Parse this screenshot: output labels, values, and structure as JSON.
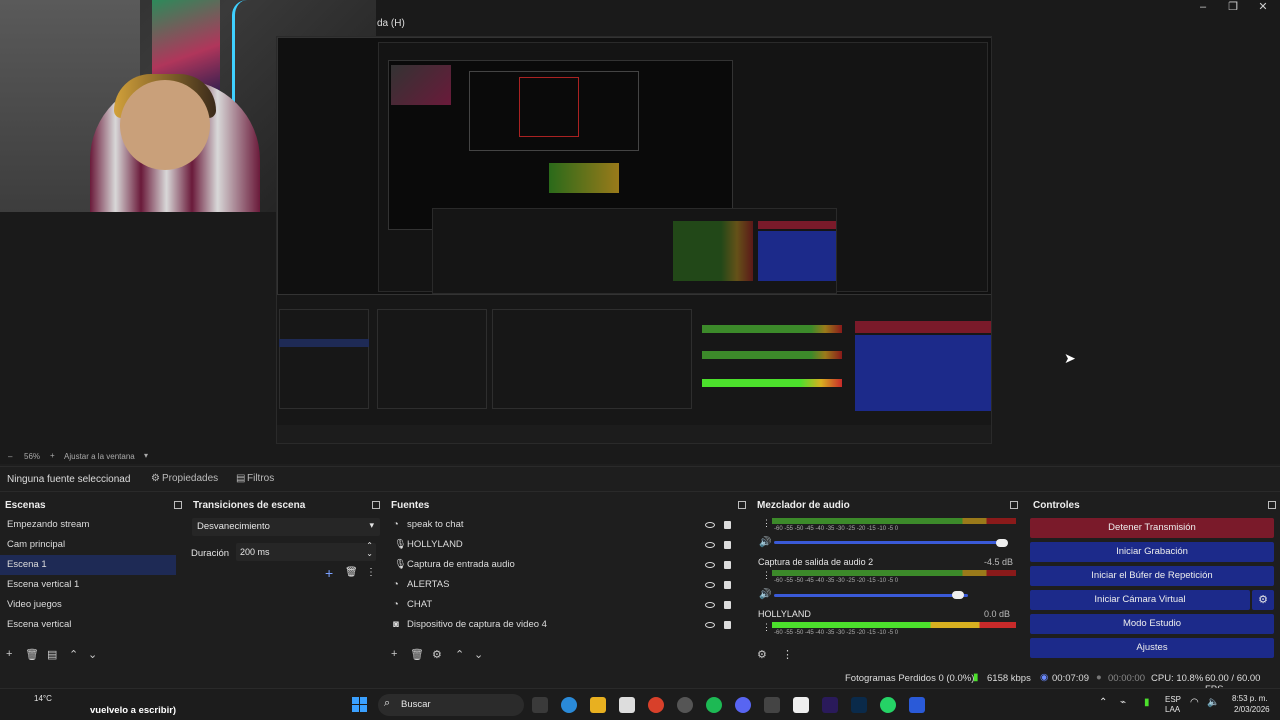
{
  "window": {
    "title_fragment": "da (H)",
    "controls": [
      "–",
      "❐",
      "✕"
    ]
  },
  "preview": {
    "zoom": "56%",
    "fit_label": "Ajustar a la ventana"
  },
  "propbar": {
    "no_source": "Ninguna fuente seleccionad",
    "properties": "Propiedades",
    "filters": "Filtros"
  },
  "scenes": {
    "title": "Escenas",
    "items": [
      "Empezando stream",
      "Cam principal",
      "Escena 1",
      "Escena vertical 1",
      "Video juegos",
      "Escena vertical"
    ],
    "selected_index": 2
  },
  "transitions": {
    "title": "Transiciones de escena",
    "selected": "Desvanecimiento",
    "duration_label": "Duración",
    "duration_value": "200 ms"
  },
  "sources": {
    "title": "Fuentes",
    "items": [
      {
        "name": "speak to chat",
        "icon": "browser-icon"
      },
      {
        "name": "HOLLYLAND",
        "icon": "microphone-icon"
      },
      {
        "name": "Captura de entrada audio",
        "icon": "microphone-icon"
      },
      {
        "name": "ALERTAS",
        "icon": "browser-icon"
      },
      {
        "name": "CHAT",
        "icon": "browser-icon"
      },
      {
        "name": "Dispositivo de captura de video 4",
        "icon": "camera-icon"
      }
    ]
  },
  "mixer": {
    "title": "Mezclador de audio",
    "ticks": "-60 -55 -50 -45 -40 -35 -30 -25 -20 -15 -10 -5 0",
    "channels": [
      {
        "name": "",
        "db": "",
        "volume": 1.0
      },
      {
        "name": "Captura de salida de audio 2",
        "db": "-4.5 dB",
        "volume": 0.81
      },
      {
        "name": "HOLLYLAND",
        "db": "0.0 dB",
        "volume": 1.0
      }
    ]
  },
  "controls": {
    "title": "Controles",
    "buttons": [
      {
        "label": "Detener Transmisión",
        "style": "red"
      },
      {
        "label": "Iniciar Grabación",
        "style": "blue"
      },
      {
        "label": "Iniciar el Búfer de Repetición",
        "style": "blue"
      },
      {
        "label": "Iniciar Cámara Virtual",
        "style": "blue"
      },
      {
        "label": "Modo Estudio",
        "style": "blue"
      },
      {
        "label": "Ajustes",
        "style": "blue"
      }
    ]
  },
  "status": {
    "dropped": "Fotogramas Perdidos 0 (0.0%)",
    "bitrate": "6158 kbps",
    "stream_time": "00:07:09",
    "rec_time": "00:00:00",
    "cpu": "CPU: 10.8%",
    "fps": "60.00 / 60.00 FPS"
  },
  "taskbar": {
    "weather": "14°C",
    "notification": "vuelvelo a escribir)",
    "search": "Buscar",
    "lang1": "ESP",
    "lang2": "LAA",
    "time": "8:53 p. m.",
    "date": "2/03/2026"
  },
  "colors": {
    "accent_blue": "#1c2a8a",
    "accent_red": "#7a1a2a",
    "selection": "#1e2a55"
  }
}
